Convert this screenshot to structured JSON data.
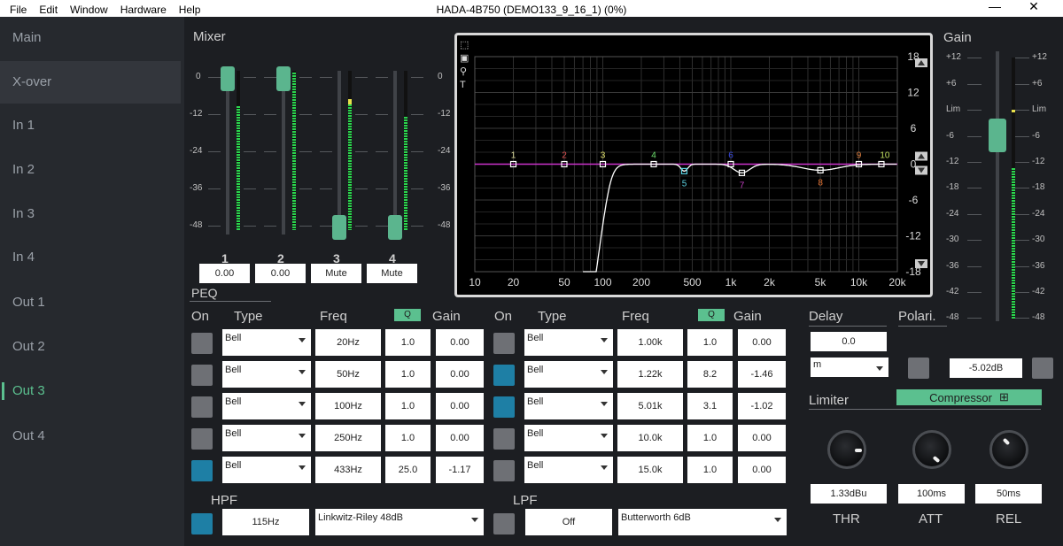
{
  "titlebar": {
    "menus": [
      "File",
      "Edit",
      "Window",
      "Hardware",
      "Help"
    ],
    "title": "HADA-4B750 (DEMO133_9_16_1) (0%)",
    "minimize": "—",
    "close": "✕"
  },
  "sidebar": {
    "items": [
      "Main",
      "X-over",
      "In 1",
      "In 2",
      "In 3",
      "In 4",
      "Out 1",
      "Out 2",
      "Out 3",
      "Out 4"
    ],
    "selected": "X-over",
    "active": "Out 3"
  },
  "mixer": {
    "title": "Mixer",
    "scale": [
      "0",
      "-12",
      "-24",
      "-36",
      "-48"
    ],
    "channels": [
      {
        "name": "1",
        "value": "0.00",
        "level": 0
      },
      {
        "name": "2",
        "value": "0.00",
        "level": 0
      },
      {
        "name": "3",
        "value": "Mute",
        "level": -48
      },
      {
        "name": "4",
        "value": "Mute",
        "level": -48
      }
    ]
  },
  "gain": {
    "title": "Gain",
    "scale": [
      "+12",
      "+6",
      "Lim",
      "-6",
      "-12",
      "-18",
      "-24",
      "-30",
      "-36",
      "-42",
      "-48"
    ],
    "level": -6
  },
  "peq": {
    "title": "PEQ",
    "headers": {
      "on": "On",
      "type": "Type",
      "freq": "Freq",
      "q": "Q",
      "gain": "Gain"
    },
    "bands_left": [
      {
        "on": false,
        "type": "Bell",
        "freq": "20Hz",
        "q": "1.0",
        "gain": "0.00"
      },
      {
        "on": false,
        "type": "Bell",
        "freq": "50Hz",
        "q": "1.0",
        "gain": "0.00"
      },
      {
        "on": false,
        "type": "Bell",
        "freq": "100Hz",
        "q": "1.0",
        "gain": "0.00"
      },
      {
        "on": false,
        "type": "Bell",
        "freq": "250Hz",
        "q": "1.0",
        "gain": "0.00"
      },
      {
        "on": true,
        "type": "Bell",
        "freq": "433Hz",
        "q": "25.0",
        "gain": "-1.17"
      }
    ],
    "bands_right": [
      {
        "on": false,
        "type": "Bell",
        "freq": "1.00k",
        "q": "1.0",
        "gain": "0.00"
      },
      {
        "on": true,
        "type": "Bell",
        "freq": "1.22k",
        "q": "8.2",
        "gain": "-1.46"
      },
      {
        "on": true,
        "type": "Bell",
        "freq": "5.01k",
        "q": "3.1",
        "gain": "-1.02"
      },
      {
        "on": false,
        "type": "Bell",
        "freq": "10.0k",
        "q": "1.0",
        "gain": "0.00"
      },
      {
        "on": false,
        "type": "Bell",
        "freq": "15.0k",
        "q": "1.0",
        "gain": "0.00"
      }
    ]
  },
  "hpf": {
    "label": "HPF",
    "on": true,
    "freq": "115Hz",
    "type": "Linkwitz-Riley 48dB"
  },
  "lpf": {
    "label": "LPF",
    "on": false,
    "freq": "Off",
    "type": "Butterworth 6dB"
  },
  "delay": {
    "title": "Delay",
    "value": "0.0",
    "unit": "m"
  },
  "polarity": {
    "title": "Polari.",
    "gain": "-5.02dB"
  },
  "limiter": {
    "title": "Limiter",
    "mode": "Compressor",
    "mode_icon": "⊞",
    "thr": "1.33dBu",
    "att": "100ms",
    "rel": "50ms",
    "thr_label": "THR",
    "att_label": "ATT",
    "rel_label": "REL"
  },
  "eq_graph": {
    "x_ticks": [
      "10",
      "20",
      "50",
      "100",
      "200",
      "500",
      "1k",
      "2k",
      "5k",
      "10k",
      "20k"
    ],
    "y_ticks": [
      "18",
      "12",
      "6",
      "0",
      "-6",
      "-12",
      "-18"
    ],
    "markers": [
      "1",
      "2",
      "3",
      "4",
      "5",
      "6",
      "7",
      "8",
      "9",
      "10"
    ],
    "colors": {
      "curve": "#ffffff",
      "flat": "#cc33cc",
      "accent": "#5bc08f"
    }
  }
}
